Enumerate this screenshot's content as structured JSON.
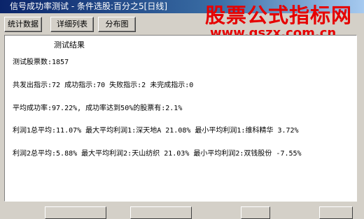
{
  "window": {
    "title": "信号成功率测试 - 条件选股:百分之5[日线]"
  },
  "watermark": {
    "title": "股票公式指标网",
    "url": "www.gszx.com.cn"
  },
  "tabs": [
    {
      "label": "统计数据"
    },
    {
      "label": "详细列表"
    },
    {
      "label": "分布图"
    }
  ],
  "results": {
    "heading": "测试结果",
    "lines": [
      "测试股票数:1857",
      "共发出指示:72 成功指示:70 失败指示:2 未完成指示:0",
      "平均成功率:97.22%, 成功率达到50%的股票有:2.1%",
      "利润1总平均:11.07% 最大平均利润1:深天地A  21.08% 最小平均利润1:维科精华 3.72%",
      "利润2总平均:5.88% 最大平均利润2:天山纺织 21.03% 最小平均利润2:双钱股份 -7.55%"
    ]
  }
}
